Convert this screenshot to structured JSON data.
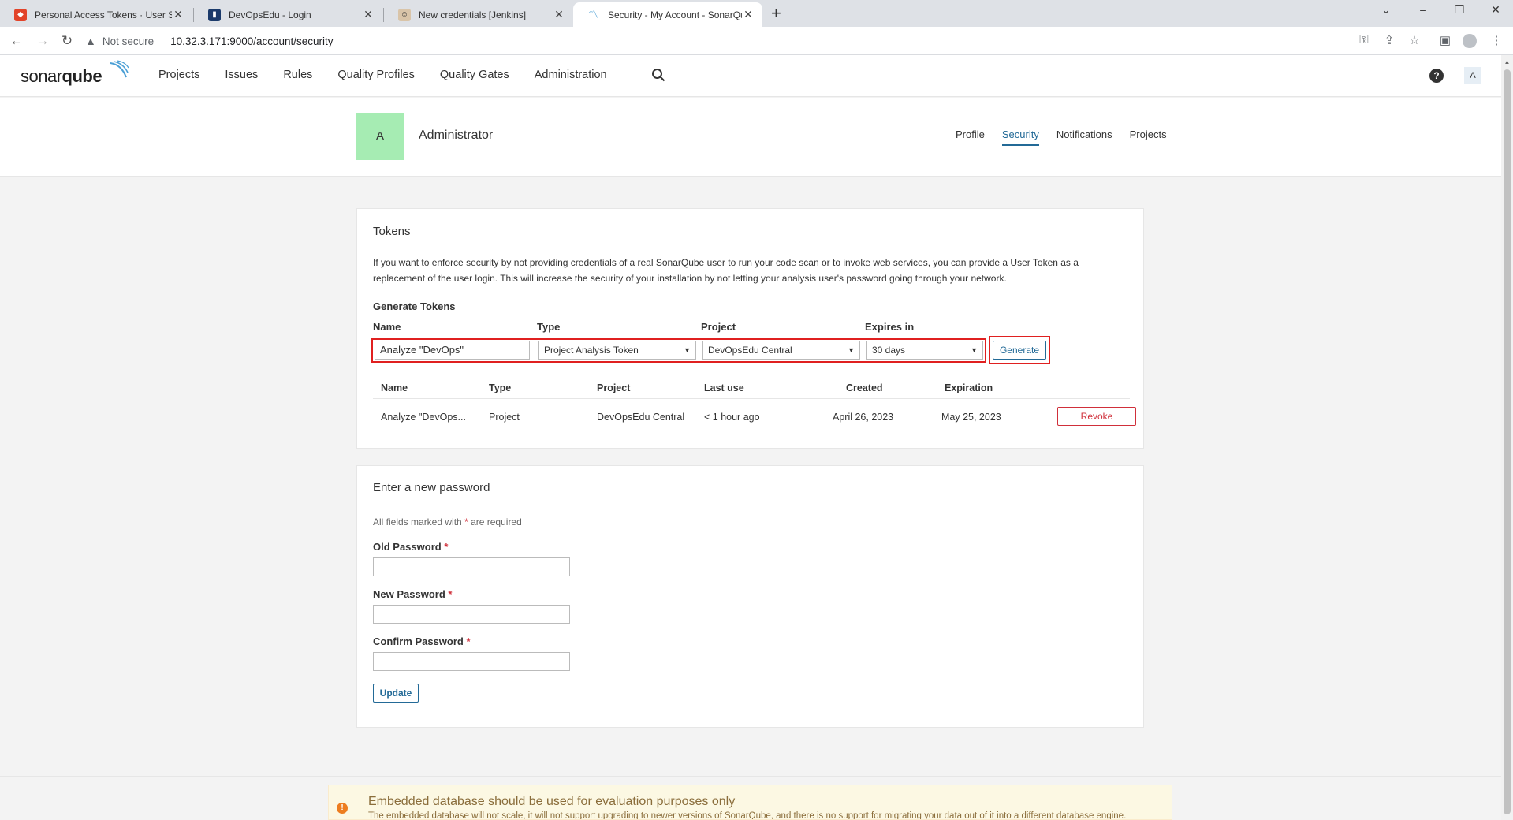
{
  "browser": {
    "tabs": [
      {
        "title": "Personal Access Tokens · User Se",
        "favicon": "gitlab-icon"
      },
      {
        "title": "DevOpsEdu - Login",
        "favicon": "devopsedu-icon"
      },
      {
        "title": "New credentials [Jenkins]",
        "favicon": "jenkins-icon"
      },
      {
        "title": "Security - My Account - SonarQu",
        "favicon": "sonarqube-icon",
        "active": true
      }
    ],
    "new_tab": "+",
    "not_secure": "Not secure",
    "url": "10.32.3.171:9000/account/security"
  },
  "header": {
    "logo_left": "sonar",
    "logo_right": "qube",
    "nav": [
      "Projects",
      "Issues",
      "Rules",
      "Quality Profiles",
      "Quality Gates",
      "Administration"
    ],
    "help": "?",
    "avatar_letter": "A"
  },
  "account": {
    "avatar_letter": "A",
    "name": "Administrator",
    "tabs": [
      "Profile",
      "Security",
      "Notifications",
      "Projects"
    ],
    "active_tab": "Security"
  },
  "tokens": {
    "heading": "Tokens",
    "description": "If you want to enforce security by not providing credentials of a real SonarQube user to run your code scan or to invoke web services, you can provide a User Token as a replacement of the user login. This will increase the security of your installation by not letting your analysis user's password going through your network.",
    "generate_heading": "Generate Tokens",
    "labels": {
      "name": "Name",
      "type": "Type",
      "project": "Project",
      "expires": "Expires in"
    },
    "form": {
      "name_value": "Analyze \"DevOps\"",
      "type_value": "Project Analysis Token",
      "project_value": "DevOpsEdu Central",
      "expires_value": "30 days"
    },
    "generate_label": "Generate",
    "table": {
      "columns": [
        "Name",
        "Type",
        "Project",
        "Last use",
        "Created",
        "Expiration"
      ],
      "rows": [
        {
          "name": "Analyze \"DevOps...",
          "type": "Project",
          "project": "DevOpsEdu Central",
          "last_use": "< 1 hour ago",
          "created": "April 26, 2023",
          "expiration": "May 25, 2023",
          "action": "Revoke"
        }
      ]
    }
  },
  "password": {
    "heading": "Enter a new password",
    "note_prefix": "All fields marked with",
    "note_star": "*",
    "note_suffix": "are required",
    "old_label": "Old Password",
    "new_label": "New Password",
    "confirm_label": "Confirm Password",
    "star": "*",
    "update_label": "Update"
  },
  "warning": {
    "icon": "!",
    "title": "Embedded database should be used for evaluation purposes only",
    "text": "The embedded database will not scale, it will not support upgrading to newer versions of SonarQube, and there is no support for migrating your data out of it into a different database engine."
  },
  "colors": {
    "accent": "#236a97",
    "danger": "#d02f3a",
    "highlight": "#e02020",
    "avatar": "#a6ecb3"
  }
}
